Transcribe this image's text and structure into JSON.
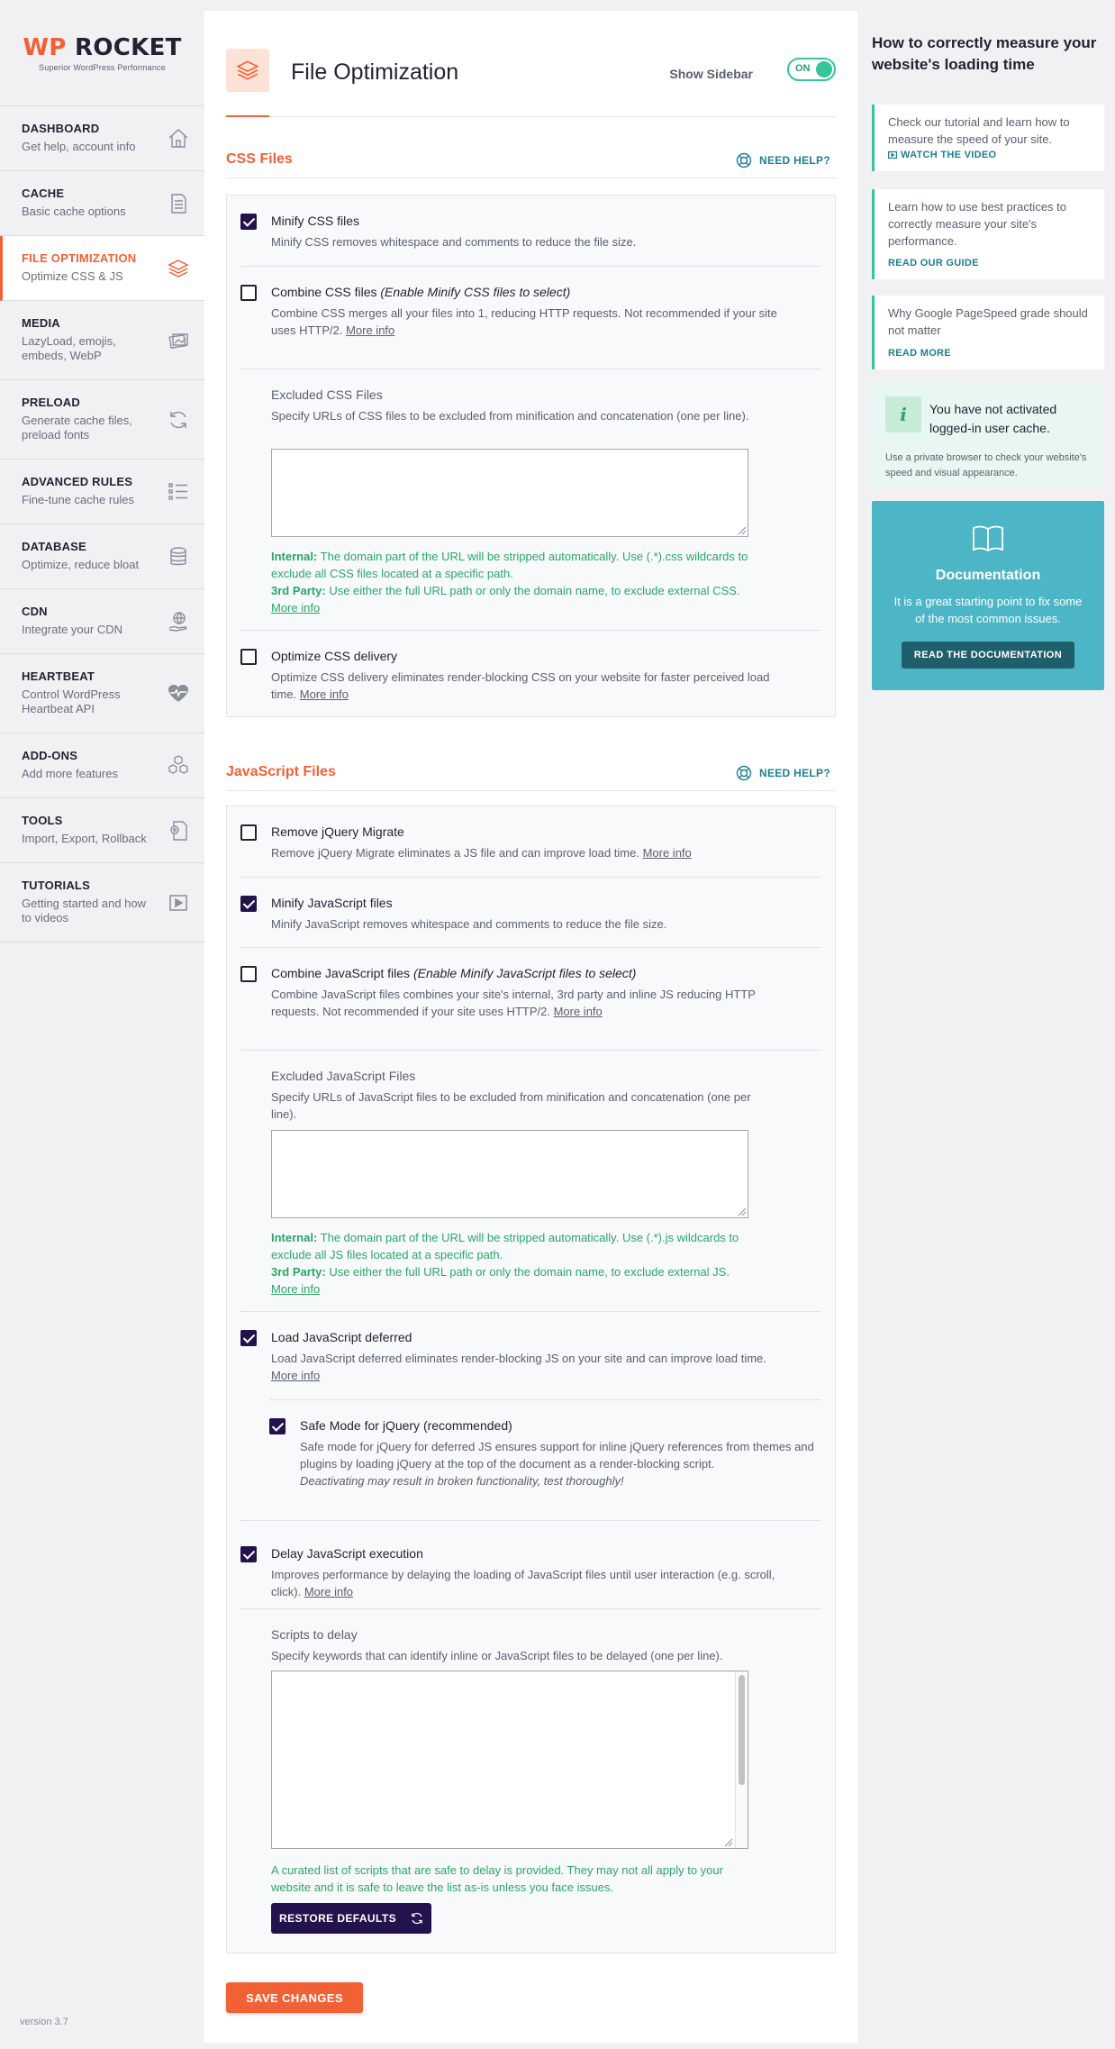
{
  "logo": {
    "brand_wp": "WP",
    "brand_rest": " ROCKET",
    "tagline": "Superior WordPress Performance"
  },
  "nav": [
    {
      "title": "DASHBOARD",
      "desc": "Get help, account info",
      "icon": "house-icon"
    },
    {
      "title": "CACHE",
      "desc": "Basic cache options",
      "icon": "document-icon"
    },
    {
      "title": "FILE OPTIMIZATION",
      "desc": "Optimize CSS & JS",
      "icon": "layers-icon",
      "active": true
    },
    {
      "title": "MEDIA",
      "desc": "LazyLoad, emojis, embeds, WebP",
      "icon": "images-icon"
    },
    {
      "title": "PRELOAD",
      "desc": "Generate cache files, preload fonts",
      "icon": "refresh-icon"
    },
    {
      "title": "ADVANCED RULES",
      "desc": "Fine-tune cache rules",
      "icon": "list-icon"
    },
    {
      "title": "DATABASE",
      "desc": "Optimize, reduce bloat",
      "icon": "database-icon"
    },
    {
      "title": "CDN",
      "desc": "Integrate your CDN",
      "icon": "globe-hand-icon"
    },
    {
      "title": "HEARTBEAT",
      "desc": "Control WordPress Heartbeat API",
      "icon": "heartbeat-icon"
    },
    {
      "title": "ADD-ONS",
      "desc": "Add more features",
      "icon": "cubes-icon"
    },
    {
      "title": "TOOLS",
      "desc": "Import, Export, Rollback",
      "icon": "gear-document-icon"
    },
    {
      "title": "TUTORIALS",
      "desc": "Getting started and how to videos",
      "icon": "play-icon"
    }
  ],
  "version": "version 3.7",
  "header": {
    "title": "File Optimization",
    "show_sidebar_label": "Show Sidebar",
    "toggle_text": "ON",
    "toggle_on": true
  },
  "css_section": {
    "title": "CSS Files",
    "need_help": "NEED HELP?",
    "minify": {
      "label": "Minify CSS files",
      "desc": "Minify CSS removes whitespace and comments to reduce the file size.",
      "checked": true
    },
    "combine": {
      "label": "Combine CSS files ",
      "label_note": "(Enable Minify CSS files to select)",
      "desc": "Combine CSS merges all your files into 1, reducing HTTP requests. Not recommended if your site uses HTTP/2. ",
      "more": "More info",
      "checked": false
    },
    "excluded": {
      "title": "Excluded CSS Files",
      "desc": "Specify URLs of CSS files to be excluded from minification and concatenation (one per line).",
      "internal_label": "Internal:",
      "internal_text": " The domain part of the URL will be stripped automatically. Use (.*).css wildcards to exclude all CSS files located at a specific path.",
      "third_label": "3rd Party:",
      "third_text": " Use either the full URL path or only the domain name, to exclude external CSS. ",
      "more": "More info"
    },
    "optimize_delivery": {
      "label": "Optimize CSS delivery",
      "desc": "Optimize CSS delivery eliminates render-blocking CSS on your website for faster perceived load time. ",
      "more": "More info",
      "checked": false
    }
  },
  "js_section": {
    "title": "JavaScript Files",
    "need_help": "NEED HELP?",
    "jquery_migrate": {
      "label": "Remove jQuery Migrate",
      "desc": "Remove jQuery Migrate eliminates a JS file and can improve load time. ",
      "more": "More info",
      "checked": false
    },
    "minify": {
      "label": "Minify JavaScript files",
      "desc": "Minify JavaScript removes whitespace and comments to reduce the file size.",
      "checked": true
    },
    "combine": {
      "label": "Combine JavaScript files ",
      "label_note": "(Enable Minify JavaScript files to select)",
      "desc": "Combine JavaScript files combines your site's internal, 3rd party and inline JS reducing HTTP requests. Not recommended if your site uses HTTP/2. ",
      "more": "More info",
      "checked": false
    },
    "excluded": {
      "title": "Excluded JavaScript Files",
      "desc": "Specify URLs of JavaScript files to be excluded from minification and concatenation (one per line).",
      "internal_label": "Internal:",
      "internal_text": " The domain part of the URL will be stripped automatically. Use (.*).js wildcards to exclude all JS files located at a specific path.",
      "third_label": "3rd Party:",
      "third_text": " Use either the full URL path or only the domain name, to exclude external JS. ",
      "more": "More info"
    },
    "deferred": {
      "label": "Load JavaScript deferred",
      "desc": "Load JavaScript deferred eliminates render-blocking JS on your site and can improve load time. ",
      "more": "More info",
      "checked": true
    },
    "safe_mode": {
      "label": "Safe Mode for jQuery (recommended)",
      "desc": "Safe mode for jQuery for deferred JS ensures support for inline jQuery references from themes and plugins by loading jQuery at the top of the document as a render-blocking script.",
      "warning": "Deactivating may result in broken functionality, test thoroughly!",
      "checked": true
    },
    "delay": {
      "label": "Delay JavaScript execution",
      "desc": "Improves performance by delaying the loading of JavaScript files until user interaction (e.g. scroll, click). ",
      "more": "More info",
      "checked": true
    },
    "scripts": {
      "title": "Scripts to delay",
      "desc": "Specify keywords that can identify inline or JavaScript files to be delayed (one per line).",
      "note": "A curated list of scripts that are safe to delay is provided. They may not all apply to your website and it is safe to leave the list as-is unless you face issues.",
      "restore_label": "RESTORE DEFAULTS"
    }
  },
  "save_label": "SAVE CHANGES",
  "aside": {
    "title": "How to correctly measure your website's loading time",
    "tips": [
      {
        "text": "Check our tutorial and learn how to measure the speed of your site.",
        "link": "WATCH THE VIDEO"
      },
      {
        "text": "Learn how to use best practices to correctly measure your site's performance.",
        "link": "READ OUR GUIDE"
      },
      {
        "text": "Why Google PageSpeed grade should not matter",
        "link": "READ MORE"
      }
    ],
    "cache": {
      "icon_text": "i",
      "title": "You have not activated logged-in user cache.",
      "desc": "Use a private browser to check your website's speed and visual appearance."
    },
    "docs": {
      "title": "Documentation",
      "desc": "It is a great starting point to fix some of the most common issues.",
      "button": "READ THE DOCUMENTATION"
    }
  },
  "colors": {
    "accent": "#f26136",
    "checkbox": "#24124c",
    "green": "#2ba66b",
    "teal": "#4cb6c6",
    "link": "#1c7f91"
  }
}
